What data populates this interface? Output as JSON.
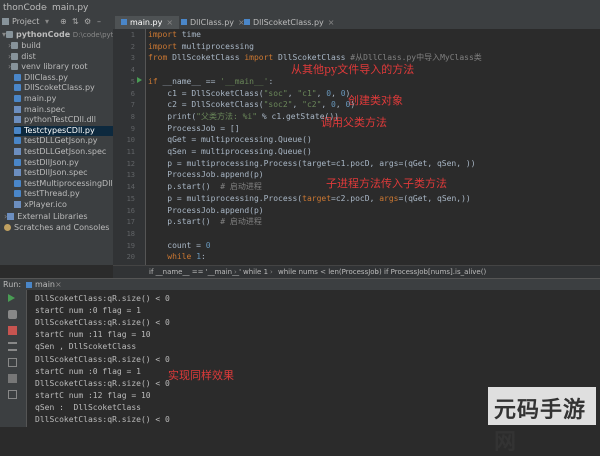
{
  "titlebar": {
    "project": "thonCode",
    "file": "main.py"
  },
  "project_panel": {
    "label": "Project",
    "root_name": "pythonCode",
    "root_path": "D:\\code\\python\\",
    "items": [
      {
        "label": "build",
        "kind": "folder"
      },
      {
        "label": "dist",
        "kind": "folder"
      },
      {
        "label": "venv  library root",
        "kind": "folder"
      },
      {
        "label": "DllClass.py",
        "kind": "py"
      },
      {
        "label": "DllScoketClass.py",
        "kind": "py"
      },
      {
        "label": "main.py",
        "kind": "py"
      },
      {
        "label": "main.spec",
        "kind": "file"
      },
      {
        "label": "pythonTestCDll.dll",
        "kind": "file"
      },
      {
        "label": "TestctypesCDll.py",
        "kind": "py",
        "selected": true
      },
      {
        "label": "testDLLGetJson.py",
        "kind": "py"
      },
      {
        "label": "testDLLGetJson.spec",
        "kind": "file"
      },
      {
        "label": "testDllJson.py",
        "kind": "py"
      },
      {
        "label": "testDllJson.spec",
        "kind": "file"
      },
      {
        "label": "testMultiprocessingDll.py",
        "kind": "py"
      },
      {
        "label": "testThread.py",
        "kind": "py"
      },
      {
        "label": "xPlayer.ico",
        "kind": "file"
      }
    ],
    "external_libraries": "External Libraries",
    "scratches": "Scratches and Consoles"
  },
  "tabs": [
    {
      "label": "main.py",
      "active": true
    },
    {
      "label": "DllClass.py",
      "active": false
    },
    {
      "label": "DllScoketClass.py",
      "active": false
    }
  ],
  "code": {
    "lines": [
      {
        "n": "1",
        "html": "<span class='kw'>import</span> time"
      },
      {
        "n": "2",
        "html": "<span class='kw'>import</span> multiprocessing"
      },
      {
        "n": "3",
        "html": "<span class='kw'>from</span> DllScoketClass <span class='kw'>import</span> DllScoketClass <span class='cm'>#从DllClass.py中导入MyClass类</span>"
      },
      {
        "n": "4",
        "html": ""
      },
      {
        "n": "5",
        "html": "<span class='kw'>if</span> __name__ == <span class='str'>'__main__'</span>:"
      },
      {
        "n": "6",
        "html": "    c1 = DllScoketClass(<span class='str'>\"soc\"</span>, <span class='str'>\"c1\"</span>, <span class='num'>0</span>, <span class='num'>0</span>)"
      },
      {
        "n": "7",
        "html": "    c2 = DllScoketClass(<span class='str'>\"soc2\"</span>, <span class='str'>\"c2\"</span>, <span class='num'>0</span>, <span class='num'>0</span>)"
      },
      {
        "n": "8",
        "html": "    print(<span class='str'>\"父类方法: %i\"</span> % c1.getState())"
      },
      {
        "n": "9",
        "html": "    ProcessJob = []"
      },
      {
        "n": "10",
        "html": "    qGet = multiprocessing.Queue()"
      },
      {
        "n": "11",
        "html": "    qSen = multiprocessing.Queue()"
      },
      {
        "n": "12",
        "html": "    p = multiprocessing.Process(target=c1.pocD, args=(qGet, qSen, ))"
      },
      {
        "n": "13",
        "html": "    ProcessJob.append(p)"
      },
      {
        "n": "14",
        "html": "    p.start()  <span class='cm'># 启动进程</span>"
      },
      {
        "n": "15",
        "html": "    p = multiprocessing.Process(<span class='kw'>target</span>=c2.pocD, <span class='kw'>args</span>=(qGet, qSen,))"
      },
      {
        "n": "16",
        "html": "    ProcessJob.append(p)"
      },
      {
        "n": "17",
        "html": "    p.start()  <span class='cm'># 启动进程</span>"
      },
      {
        "n": "18",
        "html": ""
      },
      {
        "n": "19",
        "html": "    count = <span class='num'>0</span>"
      },
      {
        "n": "20",
        "html": "    <span class='kw'>while</span> <span class='num'>1</span>:"
      }
    ],
    "annotations": [
      "从其他py文件导入的方法",
      "创建类对象",
      "调用父类方法",
      "子进程方法传入子类方法"
    ]
  },
  "breadcrumbs": [
    "if __name__ == '__main__'",
    "while 1",
    "while nums < len(ProcessJob)",
    "if ProcessJob[nums].is_alive()"
  ],
  "run_panel": {
    "label": "Run:",
    "tab": "main",
    "output": [
      "DllScoketClass:qR.size() < 0",
      "startC num :0 flag = 1",
      "DllScoketClass:qR.size() < 0",
      "startC num :11 flag = 10",
      "qSen , DllScoketClass",
      "DllScoketClass:qR.size() < 0",
      "startC num :0 flag = 1",
      "DllScoketClass:qR.size() < 0",
      "startC num :12 flag = 10",
      "qSen :  DllScoketClass",
      "DllScoketClass:qR.size() < 0"
    ],
    "annotation": "实现同样效果"
  },
  "watermark": "元码手游网"
}
